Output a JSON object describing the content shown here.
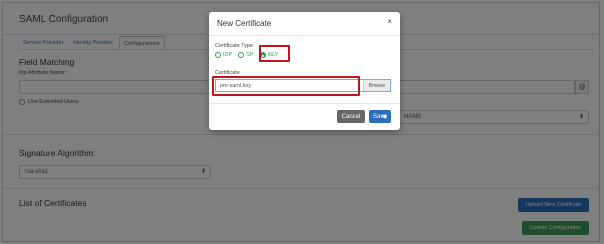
{
  "page": {
    "title": "SAML Configuration",
    "tabs": [
      {
        "label": "Service Provider"
      },
      {
        "label": "Identity Provider"
      },
      {
        "label": "Configurations"
      }
    ],
    "field_matching": {
      "title": "Field Matching",
      "idp_label": "Idp Attribute Name:",
      "at_symbol": "@",
      "extended_users_label": "Use Extended Users",
      "right_select_value": "NAME"
    },
    "signature": {
      "title": "Signature Algorithm:",
      "value": "rsa-sha1"
    },
    "certificates": {
      "title": "List of Certificates",
      "upload_label": "Upload New Certificate",
      "update_label": "Update Configuration"
    }
  },
  "modal": {
    "title": "New Certificate",
    "close": "×",
    "certificate_type_label": "Certificate Type",
    "types": [
      {
        "label": "IDP",
        "checked": false
      },
      {
        "label": "SP",
        "checked": false
      },
      {
        "label": "KEY",
        "checked": true
      }
    ],
    "certificate_label": "Certificate",
    "file_name": "pm-saml.key",
    "browse_label": "Browse",
    "cancel_label": "Cancel",
    "save_label": "Save"
  }
}
